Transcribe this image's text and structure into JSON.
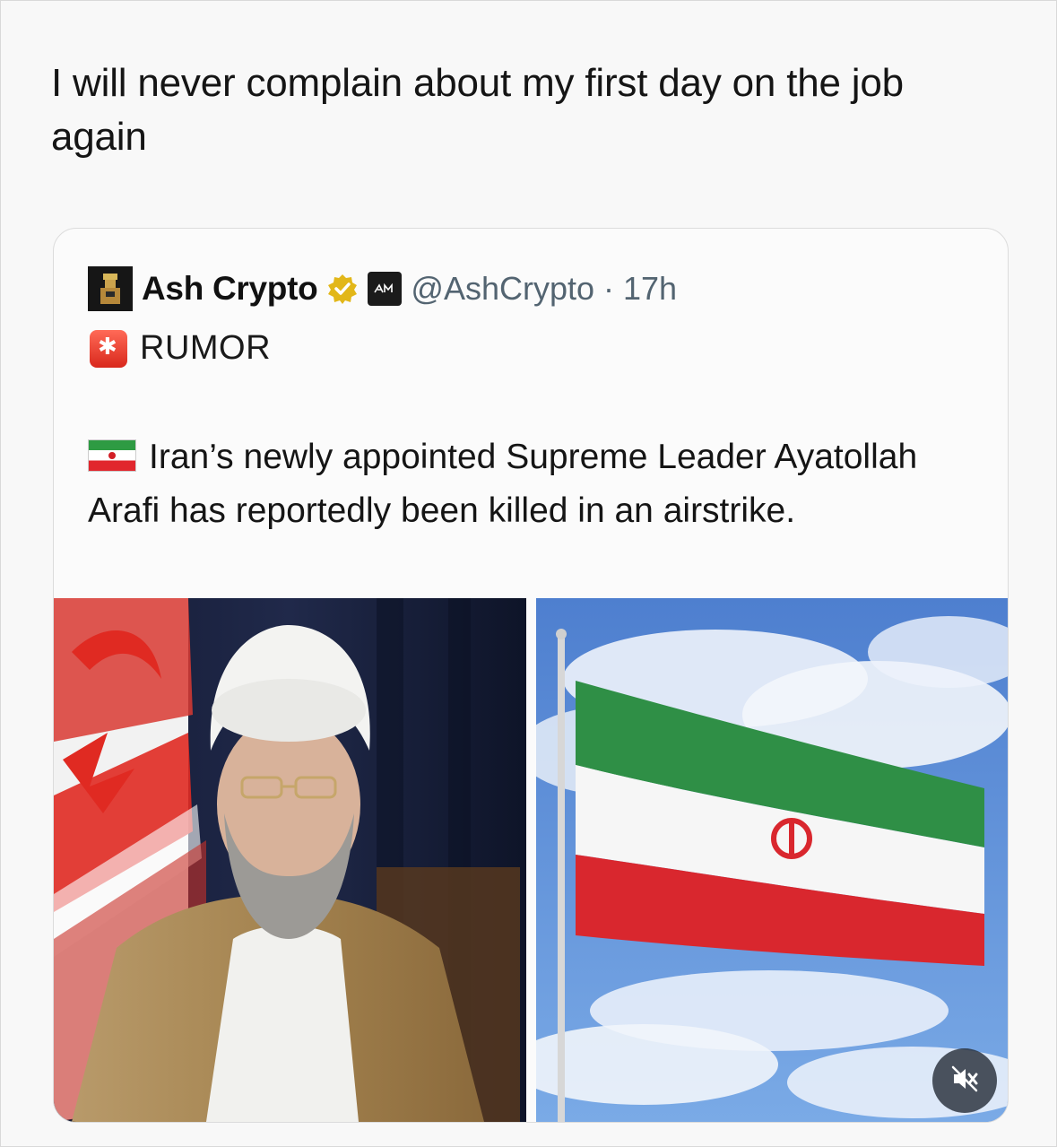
{
  "post": {
    "text": "I will never complain about my first day on the job again"
  },
  "quoted_post": {
    "author_name": "Ash Crypto",
    "handle": "@AshCrypto",
    "separator": "·",
    "time": "17h",
    "label": "RUMOR",
    "body": "Iran’s newly appointed Supreme Leader Ayatollah Arafi has reportedly been killed in an airstrike.",
    "icons": {
      "verified": "verified-badge-icon",
      "org": "affiliate-badge-icon",
      "siren": "siren-icon",
      "flag": "iran-flag-icon",
      "mute": "speaker-muted-icon"
    },
    "colors": {
      "verified_gold": "#e2b719",
      "handle_gray": "#536471",
      "iran_green": "#2e9b43",
      "iran_red": "#e1262d"
    }
  }
}
